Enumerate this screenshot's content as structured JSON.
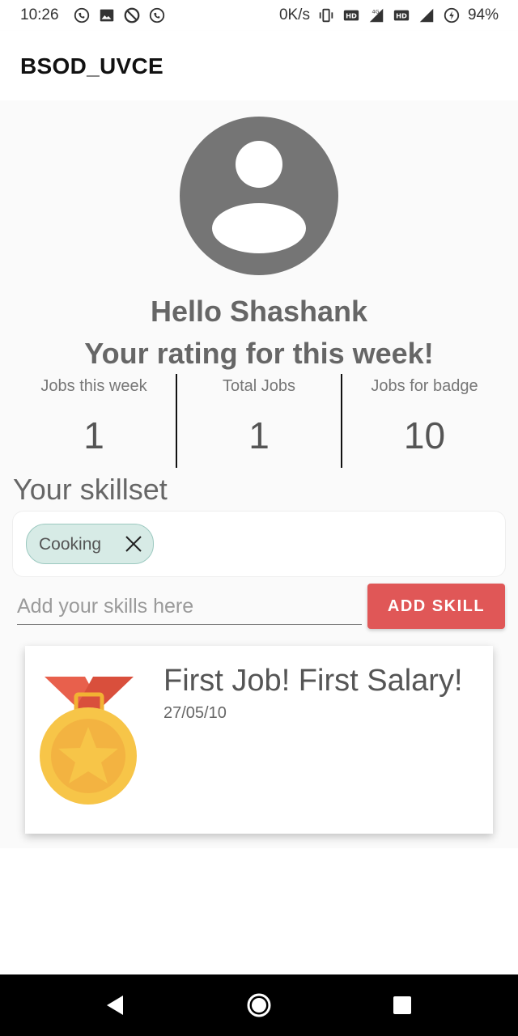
{
  "status_bar": {
    "time": "10:26",
    "speed": "0K/s",
    "battery": "94%",
    "left_icons": [
      "whatsapp-icon",
      "image-icon",
      "do-not-disturb-icon",
      "whatsapp-icon"
    ],
    "right_icons": [
      "vibrate-icon",
      "hd-icon",
      "signal-4g-icon",
      "hd-icon",
      "signal-icon",
      "battery-saver-icon"
    ]
  },
  "app_bar": {
    "title": "BSOD_UVCE"
  },
  "profile": {
    "avatar_icon": "account-circle-icon",
    "greeting": "Hello Shashank",
    "rating_line": "Your rating for this week!"
  },
  "stats": [
    {
      "label": "Jobs this week",
      "value": "1"
    },
    {
      "label": "Total Jobs",
      "value": "1"
    },
    {
      "label": "Jobs for badge",
      "value": "10"
    }
  ],
  "skills": {
    "title": "Your skillset",
    "chips": [
      {
        "label": "Cooking"
      }
    ],
    "input_placeholder": "Add your skills here",
    "input_value": "",
    "add_button_label": "ADD SKILL"
  },
  "badge": {
    "icon": "medal-icon",
    "title": "First Job! First Salary!",
    "date": "27/05/10"
  },
  "colors": {
    "accent": "#e05757",
    "chip_bg": "#d7ebe6",
    "avatar": "#757575",
    "medal_gold": "#f7c548",
    "medal_ribbon": "#e8604c"
  },
  "nav": [
    "back-icon",
    "home-icon",
    "recents-icon"
  ]
}
